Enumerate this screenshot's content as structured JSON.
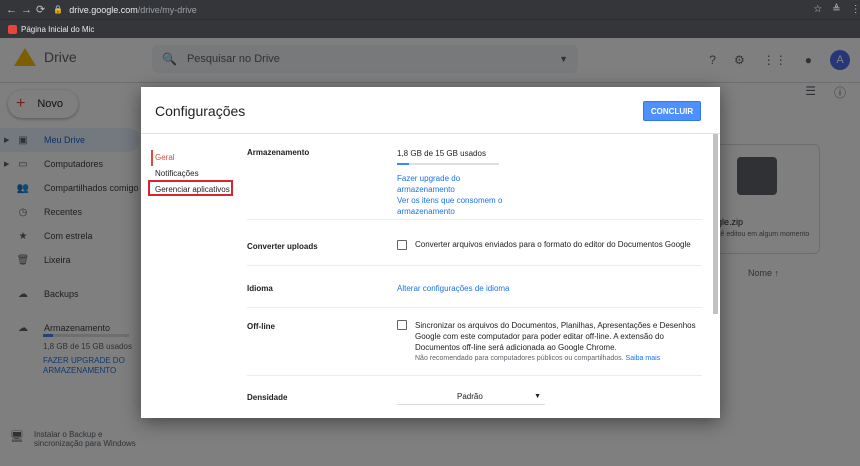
{
  "browser": {
    "url_host": "drive.google.com",
    "url_path": "/drive/my-drive",
    "bookmark": "Página Inicial do Mic"
  },
  "drive": {
    "app_name": "Drive",
    "search_placeholder": "Pesquisar no Drive",
    "avatar_letter": "A",
    "new_label": "Novo",
    "nav": [
      {
        "label": "Meu Drive",
        "icon": "my-drive-icon"
      },
      {
        "label": "Computadores",
        "icon": "computers-icon"
      },
      {
        "label": "Compartilhados comigo",
        "icon": "shared-icon"
      },
      {
        "label": "Recentes",
        "icon": "clock-icon"
      },
      {
        "label": "Com estrela",
        "icon": "star-icon"
      },
      {
        "label": "Lixeira",
        "icon": "trash-icon"
      },
      {
        "label": "Backups",
        "icon": "cloud-icon"
      },
      {
        "label": "Armazenamento",
        "icon": "storage-icon"
      }
    ],
    "storage_used": "1,8 GB de 15 GB usados",
    "storage_fraction": 0.12,
    "upgrade_link": "FAZER UPGRADE DO ARMAZENAMENTO",
    "install_text": "Instalar o Backup e sincronização para Windows",
    "file_name": "gle.zip",
    "file_sub": "cê editou em algum momento",
    "sort_label": "Nome"
  },
  "dialog": {
    "title": "Configurações",
    "done_label": "CONCLUIR",
    "nav": [
      "Geral",
      "Notificações",
      "Gerenciar aplicativos"
    ],
    "storage": {
      "label": "Armazenamento",
      "usage": "1,8 GB de 15 GB usados",
      "usage_fraction": 0.12,
      "upgrade_link": "Fazer upgrade do armazenamento",
      "items_link": "Ver os itens que consomem o armazenamento"
    },
    "convert": {
      "label": "Converter uploads",
      "text": "Converter arquivos enviados para o formato do editor do Documentos Google",
      "checked": false
    },
    "language": {
      "label": "Idioma",
      "link": "Alterar configurações de idioma"
    },
    "offline": {
      "label": "Off-line",
      "text": "Sincronizar os arquivos do Documentos, Planilhas, Apresentações e Desenhos Google com este computador para poder editar off-line. A extensão do Documentos off-line será adicionada ao Google Chrome.",
      "note": "Não recomendado para computadores públicos ou compartilhados.",
      "note_link": "Saiba mais",
      "checked": false
    },
    "density": {
      "label": "Densidade",
      "value": "Padrão"
    }
  }
}
